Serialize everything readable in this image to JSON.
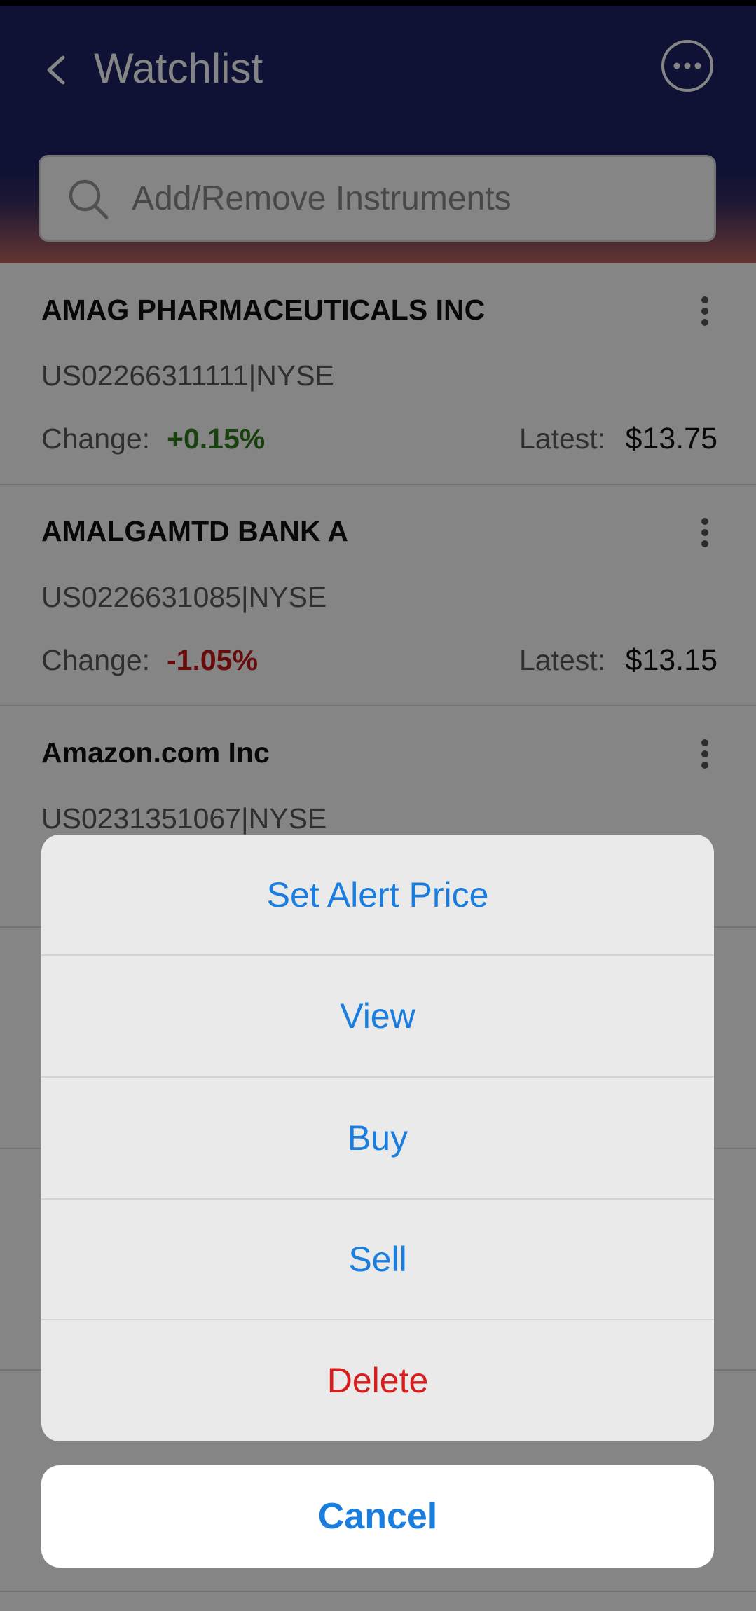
{
  "header": {
    "title": "Watchlist"
  },
  "search": {
    "placeholder": "Add/Remove Instruments",
    "value": ""
  },
  "colors": {
    "header_bg": "#1f2466",
    "positive": "#2e7d1e",
    "negative": "#c61616",
    "action_blue": "#1a7ee0",
    "destructive_red": "#d81d1d"
  },
  "watchlist": {
    "change_label": "Change:",
    "latest_label": "Latest:",
    "items": [
      {
        "name": "AMAG PHARMACEUTICALS INC",
        "code": "US02266311111|NYSE",
        "change": "+0.15%",
        "change_trend": "positive",
        "latest": "$13.75"
      },
      {
        "name": "AMALGAMTD BANK A",
        "code": "US0226631085|NYSE",
        "change": "-1.05%",
        "change_trend": "negative",
        "latest": "$13.15"
      },
      {
        "name": "Amazon.com Inc",
        "code": "US0231351067|NYSE",
        "change": "",
        "change_trend": "",
        "latest": ""
      }
    ]
  },
  "action_sheet": {
    "items": [
      {
        "label": "Set Alert Price",
        "style": "default"
      },
      {
        "label": "View",
        "style": "default"
      },
      {
        "label": "Buy",
        "style": "default"
      },
      {
        "label": "Sell",
        "style": "default"
      },
      {
        "label": "Delete",
        "style": "destructive"
      }
    ],
    "cancel_label": "Cancel"
  }
}
